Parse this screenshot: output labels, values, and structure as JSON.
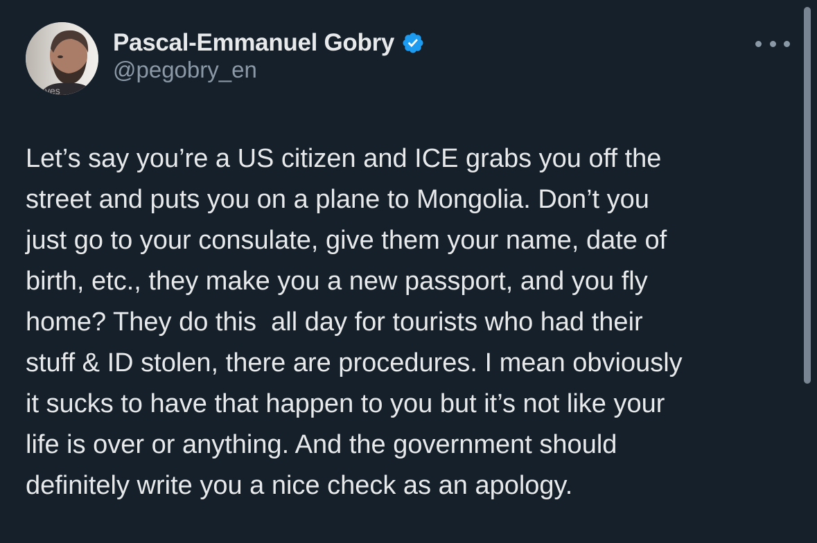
{
  "author": {
    "display_name": "Pascal-Emmanuel Gobry",
    "handle": "@pegobry_en",
    "verified": true,
    "verified_color": "#1d9bf0"
  },
  "menu": {
    "icon": "more-horizontal-icon"
  },
  "tweet": {
    "lines": [
      "Let’s say you’re a US citizen and ICE grabs you off the",
      "street and puts you on a plane to Mongolia. Don’t you",
      "just go to your consulate, give them your name, date of",
      "birth, etc., they make you a new passport, and you fly",
      "home? They do this  all day for tourists who had their",
      "stuff & ID stolen, there are procedures. I mean obviously",
      "it sucks to have that happen to you but it’s not like your",
      "life is over or anything. And the government should",
      "definitely write you a nice check as an apology."
    ]
  },
  "theme": {
    "background": "#15202b",
    "text": "#e7e9ea",
    "secondary_text": "#8b98a5"
  }
}
